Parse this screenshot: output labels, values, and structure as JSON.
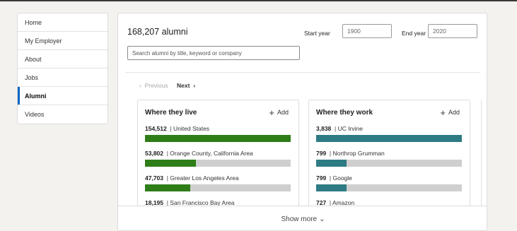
{
  "sidebar": {
    "items": [
      {
        "label": "Home",
        "active": false
      },
      {
        "label": "My Employer",
        "active": false
      },
      {
        "label": "About",
        "active": false
      },
      {
        "label": "Jobs",
        "active": false
      },
      {
        "label": "Alumni",
        "active": true
      },
      {
        "label": "Videos",
        "active": false
      }
    ]
  },
  "main": {
    "alumni_count": "168,207 alumni",
    "start_year_label": "Start year",
    "start_year_value": "1900",
    "end_year_label": "End year",
    "end_year_value": "2020",
    "search_placeholder": "Search alumni by title, keyword or company",
    "pager": {
      "previous": "Previous",
      "next": "Next",
      "prev_icon": "‹",
      "next_icon": "›"
    },
    "show_more": "Show more",
    "show_more_icon": "chevron-down-icon"
  },
  "cards": [
    {
      "title": "Where they live",
      "add_label": "Add",
      "accent": "#2e7d18",
      "rows": [
        {
          "count": "154,512",
          "label": "United States",
          "fraction": 1.0
        },
        {
          "count": "53,802",
          "label": "Orange County, California Area",
          "fraction": 0.35
        },
        {
          "count": "47,703",
          "label": "Greater Los Angeles Area",
          "fraction": 0.31
        },
        {
          "count": "18,195",
          "label": "San Francisco Bay Area",
          "fraction": 0.12
        }
      ]
    },
    {
      "title": "Where they work",
      "add_label": "Add",
      "accent": "#2e7b84",
      "rows": [
        {
          "count": "3,838",
          "label": "UC Irvine",
          "fraction": 1.0
        },
        {
          "count": "799",
          "label": "Northrop Grumman",
          "fraction": 0.21
        },
        {
          "count": "799",
          "label": "Google",
          "fraction": 0.21
        },
        {
          "count": "727",
          "label": "Amazon",
          "fraction": 0.19
        }
      ]
    }
  ]
}
